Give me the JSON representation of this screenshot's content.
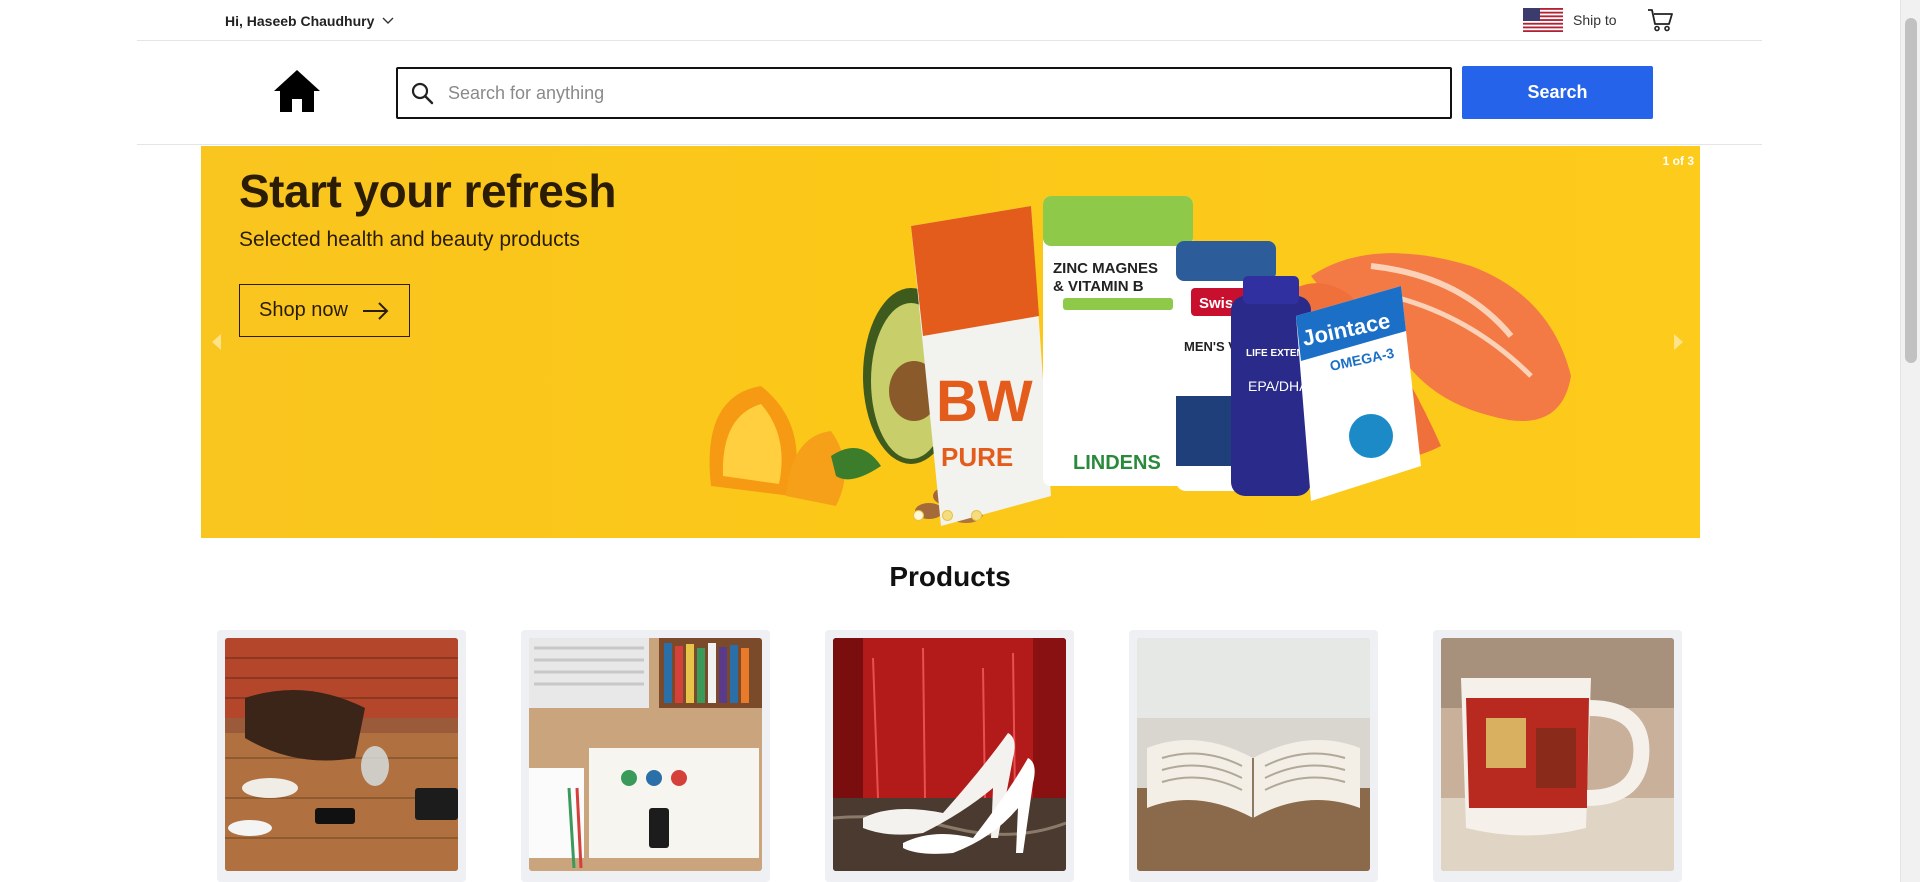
{
  "topbar": {
    "greeting": "Hi, Haseeb Chaudhury",
    "ship_to_label": "Ship to",
    "flag_icon": "us-flag-icon",
    "cart_icon": "shopping-cart-icon"
  },
  "header": {
    "home_icon": "home-icon",
    "search": {
      "placeholder": "Search for anything",
      "value": ""
    },
    "search_button_label": "Search"
  },
  "banner": {
    "title": "Start your refresh",
    "subtitle": "Selected health and beauty products",
    "cta_label": "Shop now",
    "slide_counter": "1 of 3",
    "dots": 3,
    "active_dot": 1,
    "product_labels": [
      "ZINC MAGNES",
      "& VITAMIN B",
      "Swisse",
      "MEN'S VITA",
      "LIFE EXTENSION",
      "EPA/DHA",
      "Jointace",
      "OMEGA-3",
      "LINDENS",
      "PURE"
    ],
    "colors": {
      "background": "#fbc818",
      "text": "#2b1d05"
    }
  },
  "products": {
    "title": "Products",
    "items": [
      {
        "image": "people-at-table-with-bag"
      },
      {
        "image": "desk-with-laptop-and-books"
      },
      {
        "image": "white-high-heels"
      },
      {
        "image": "open-book"
      },
      {
        "image": "vintage-mug"
      }
    ]
  },
  "colors": {
    "accent": "#2563eb"
  }
}
